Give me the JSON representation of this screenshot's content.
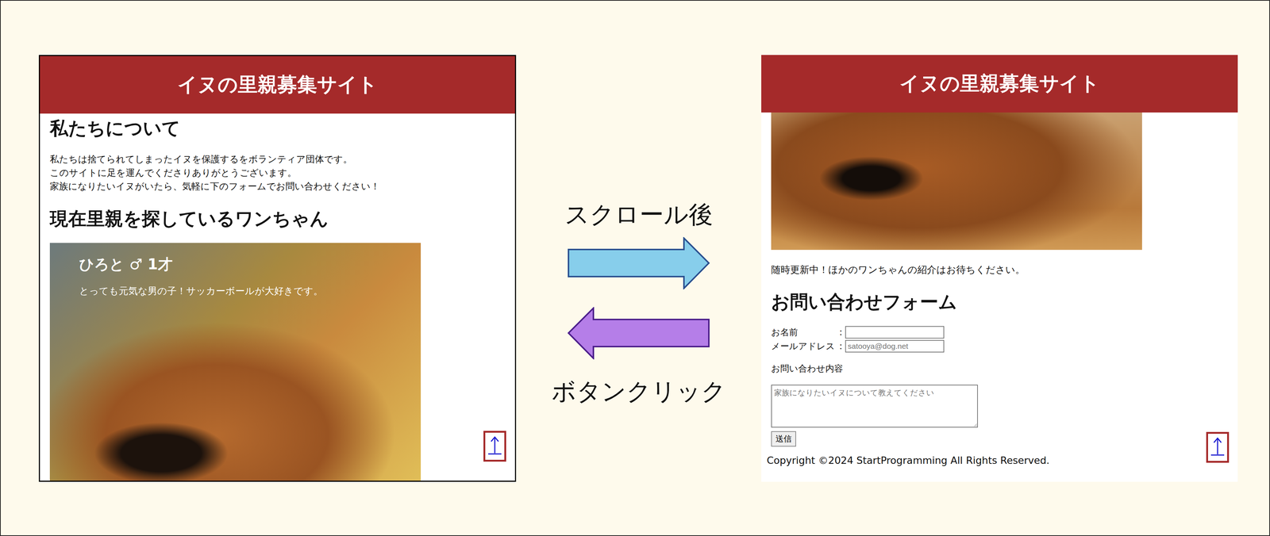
{
  "left_page": {
    "header": "イヌの里親募集サイト",
    "about_title": "私たちについて",
    "about_lines": [
      "私たちは捨てられてしまったイヌを保護するをボランティア団体です。",
      "このサイトに足を運んでくださりありがとうございます。",
      "家族になりたいイヌがいたら、気軽に下のフォームでお問い合わせください！"
    ],
    "dogs_title": "現在里親を探しているワンちゃん",
    "dog": {
      "name": "ひろと ♂ 1才",
      "description": "とっても元気な男の子！サッカーボールが大好きです。"
    }
  },
  "arrows": [
    {
      "label": "スクロール後",
      "direction": "right",
      "color": "#87ceeb"
    },
    {
      "label": "ボタンクリック",
      "direction": "left",
      "color": "#b57ee8"
    }
  ],
  "right_page": {
    "header": "イヌの里親募集サイト",
    "notice": "随時更新中！ほかのワンちゃんの紹介はお待ちください。",
    "form_title": "お問い合わせフォーム",
    "fields": [
      {
        "label": "お名前",
        "separator": ":",
        "placeholder": ""
      },
      {
        "label": "メールアドレス",
        "separator": ":",
        "placeholder": "satooya@dog.net"
      }
    ],
    "message_label": "お問い合わせ内容",
    "message_placeholder": "家族になりたいイヌについて教えてください",
    "submit": "送信",
    "copyright": "Copyright ©2024 StartProgramming All Rights Reserved."
  }
}
